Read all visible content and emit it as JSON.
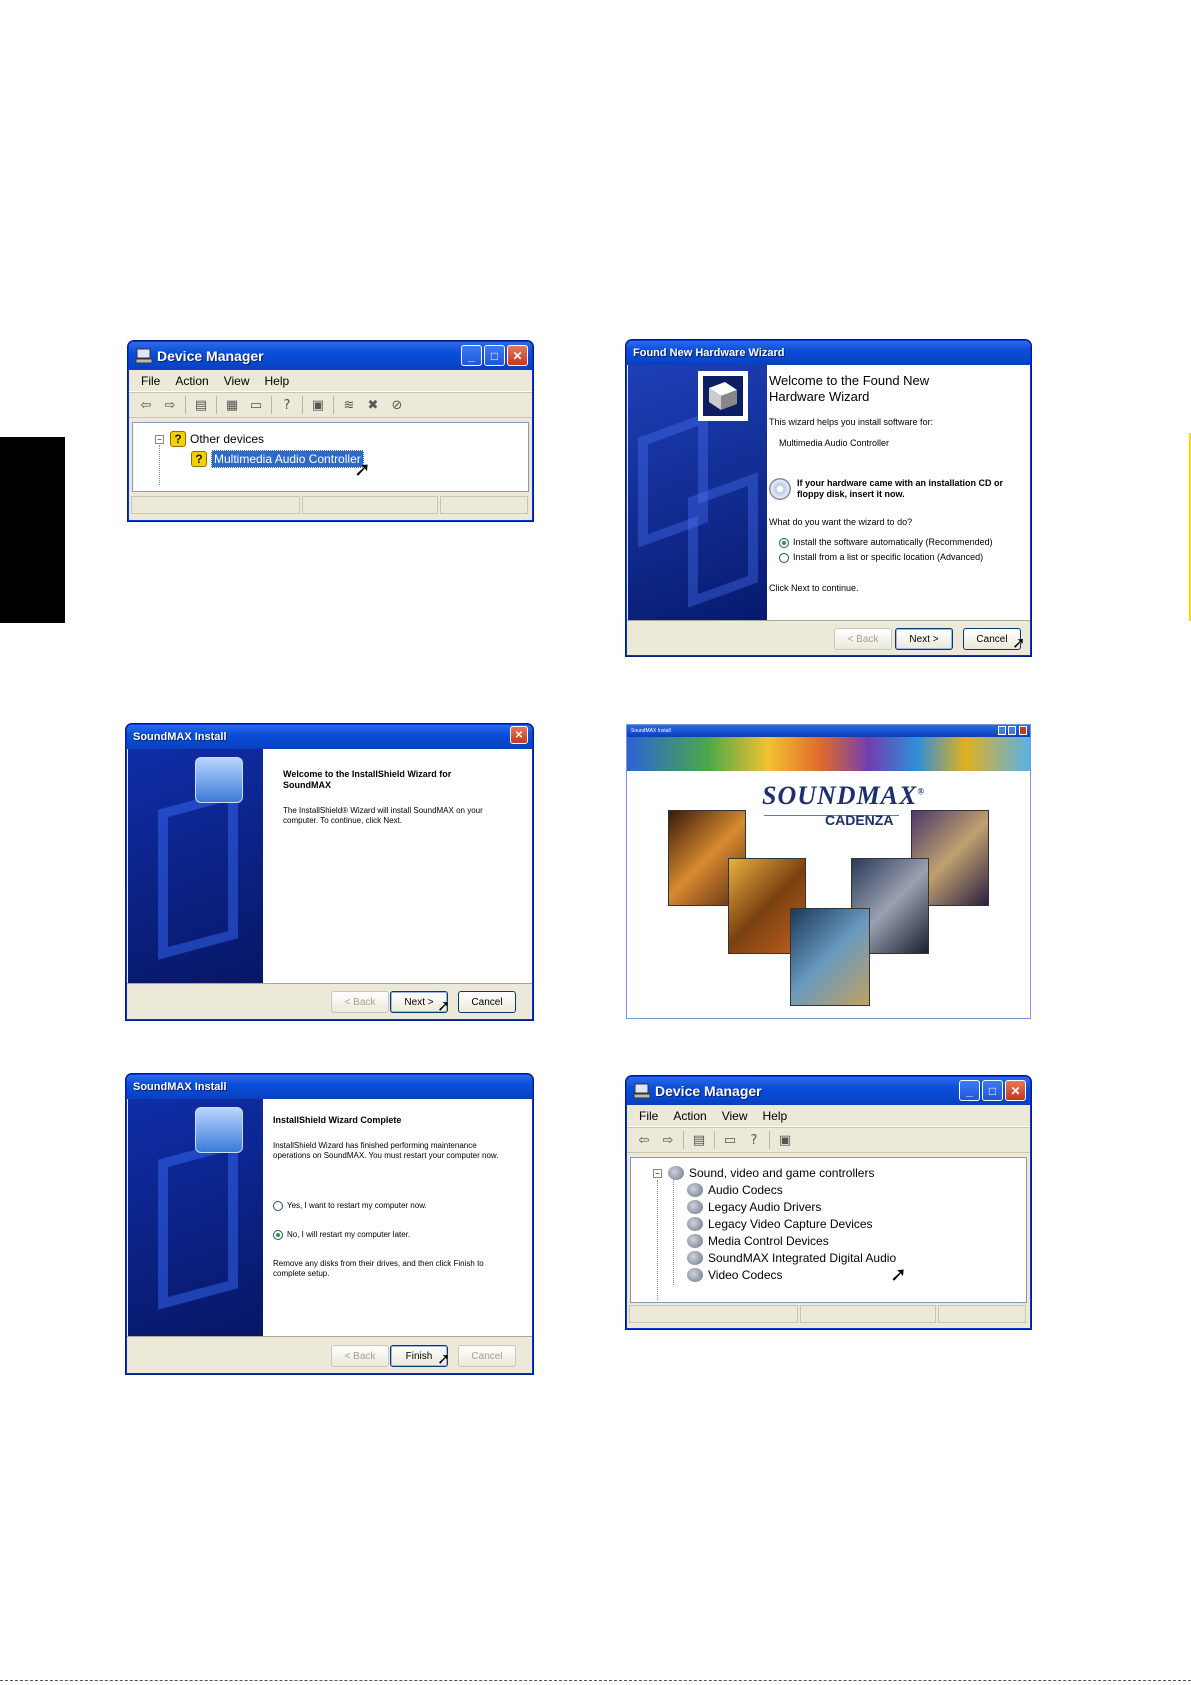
{
  "device_manager_1": {
    "title": "Device Manager",
    "menu": [
      "File",
      "Action",
      "View",
      "Help"
    ],
    "tree": {
      "category": "Other devices",
      "device": "Multimedia Audio Controller"
    }
  },
  "found_new_hardware": {
    "title": "Found New Hardware Wizard",
    "heading": "Welcome to the Found New Hardware Wizard",
    "intro": "This wizard helps you install software for:",
    "device": "Multimedia Audio Controller",
    "cd_notice": "If your hardware came with an installation CD or floppy disk, insert it now.",
    "question": "What do you want the wizard to do?",
    "option_auto": "Install the software automatically (Recommended)",
    "option_list": "Install from a list or specific location (Advanced)",
    "continue": "Click Next to continue.",
    "back": "< Back",
    "next": "Next >",
    "cancel": "Cancel"
  },
  "soundmax_install_welcome": {
    "title": "SoundMAX Install",
    "heading": "Welcome to the InstallShield Wizard for SoundMAX",
    "body": "The InstallShield® Wizard will install SoundMAX on your computer.  To continue, click Next.",
    "back": "< Back",
    "next": "Next >",
    "cancel": "Cancel"
  },
  "soundmax_splash": {
    "title": "SoundMAX Install",
    "logo": "SOUNDMAX",
    "logo_mark": "®",
    "subtitle": "CADENZA"
  },
  "soundmax_install_complete": {
    "title": "SoundMAX Install",
    "heading": "InstallShield Wizard Complete",
    "body": "InstallShield Wizard has finished performing maintenance operations on SoundMAX. You must restart your computer now.",
    "option_yes": "Yes, I want to restart my computer now.",
    "option_no": "No, I will restart my computer later.",
    "remove": "Remove any disks from their drives, and then click Finish to complete setup.",
    "back": "< Back",
    "finish": "Finish",
    "cancel": "Cancel"
  },
  "device_manager_2": {
    "title": "Device Manager",
    "menu": [
      "File",
      "Action",
      "View",
      "Help"
    ],
    "tree": {
      "category": "Sound, video and game controllers",
      "items": [
        "Audio Codecs",
        "Legacy Audio Drivers",
        "Legacy Video Capture Devices",
        "Media Control Devices",
        "SoundMAX Integrated Digital Audio",
        "Video Codecs"
      ]
    }
  }
}
